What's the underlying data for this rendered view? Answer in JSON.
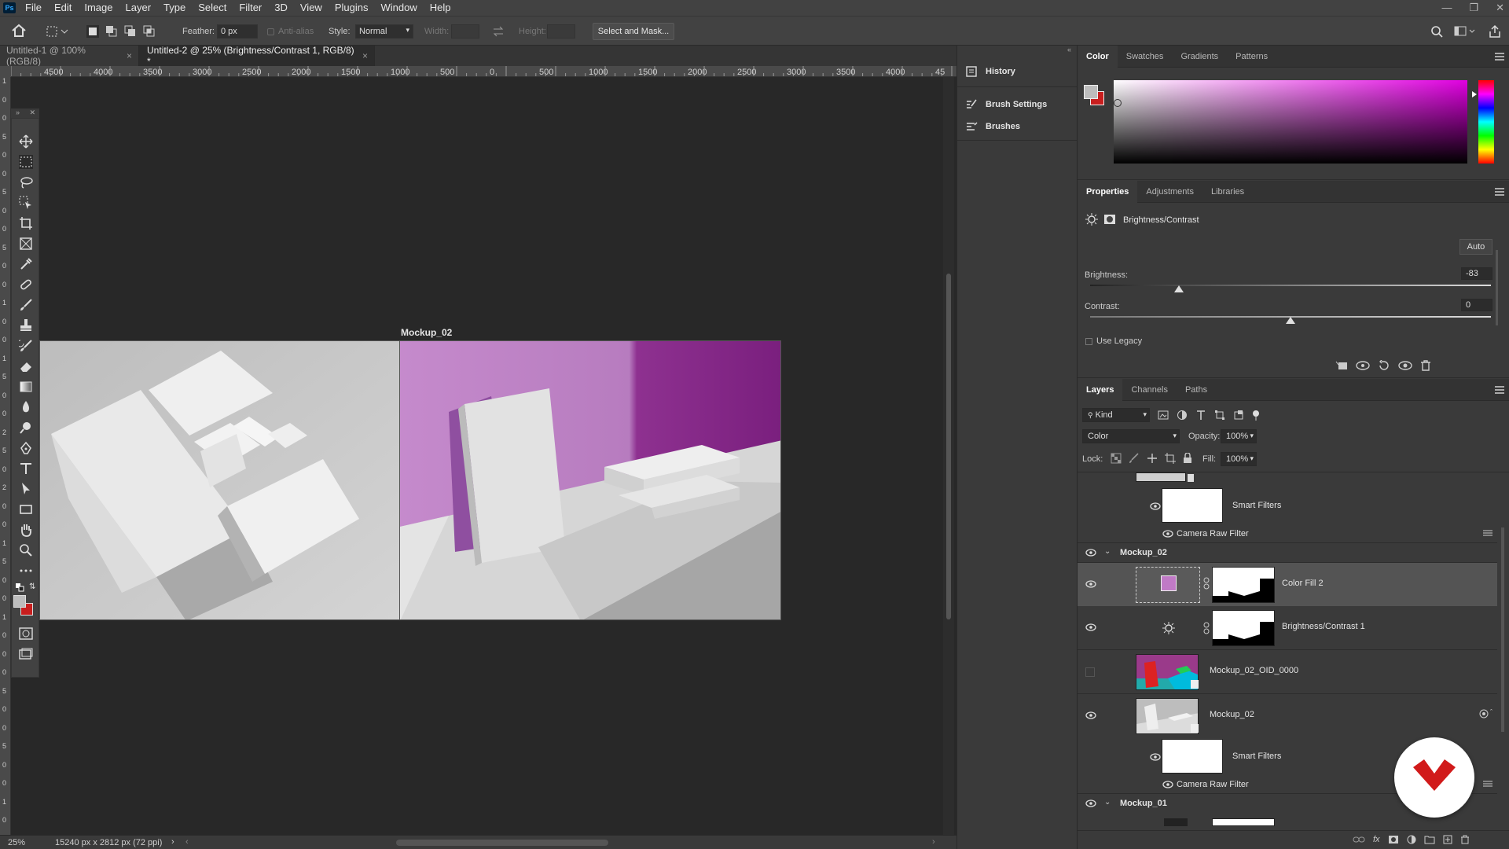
{
  "app": {
    "logo": "Ps"
  },
  "menubar": [
    "File",
    "Edit",
    "Image",
    "Layer",
    "Type",
    "Select",
    "Filter",
    "3D",
    "View",
    "Plugins",
    "Window",
    "Help"
  ],
  "options": {
    "feather_label": "Feather:",
    "feather_value": "0 px",
    "antialias_label": "Anti-alias",
    "style_label": "Style:",
    "style_value": "Normal",
    "width_label": "Width:",
    "height_label": "Height:",
    "select_mask": "Select and Mask..."
  },
  "tabs": [
    {
      "label": "Untitled-1 @ 100% (RGB/8)",
      "close": "×"
    },
    {
      "label": "Untitled-2 @ 25% (Brightness/Contrast 1, RGB/8) *",
      "close": "×"
    }
  ],
  "ruler": {
    "h_ticks": [
      "4500",
      "4000",
      "3500",
      "3000",
      "2500",
      "2000",
      "1500",
      "1000",
      "500",
      "0",
      "500",
      "1000",
      "1500",
      "2000",
      "2500",
      "3000",
      "3500",
      "4000",
      "45"
    ],
    "v_ticks": [
      "1",
      "0",
      "0",
      "5",
      "0",
      "0",
      "5",
      "0",
      "0",
      "5",
      "0",
      "0",
      "1",
      "0",
      "0",
      "1",
      "5",
      "0",
      "0",
      "2",
      "5",
      "0",
      "2",
      "0",
      "0",
      "1",
      "5",
      "0",
      "0",
      "1",
      "0",
      "0",
      "0",
      "5",
      "0",
      "0",
      "5",
      "0",
      "0",
      "1",
      "0"
    ]
  },
  "canvas": {
    "artboard_label": "Mockup_02"
  },
  "status": {
    "zoom": "25%",
    "doc_size": "15240 px x 2812 px (72 ppi)",
    "arrow": "›"
  },
  "midpanel": {
    "history": "History",
    "brush_settings": "Brush Settings",
    "brushes": "Brushes"
  },
  "color_panel": {
    "tabs": [
      "Color",
      "Swatches",
      "Gradients",
      "Patterns"
    ],
    "fg": "#bdbdbd",
    "bg": "#c81e1e"
  },
  "properties": {
    "tabs": [
      "Properties",
      "Adjustments",
      "Libraries"
    ],
    "title": "Brightness/Contrast",
    "auto": "Auto",
    "brightness_label": "Brightness:",
    "brightness_value": "-83",
    "contrast_label": "Contrast:",
    "contrast_value": "0",
    "use_legacy": "Use Legacy"
  },
  "layers_panel": {
    "tabs": [
      "Layers",
      "Channels",
      "Paths"
    ],
    "kind": "Kind",
    "blend_mode": "Color",
    "opacity_label": "Opacity:",
    "opacity_value": "100%",
    "lock_label": "Lock:",
    "fill_label": "Fill:",
    "fill_value": "100%",
    "layers": {
      "smart_filters_top": "Smart Filters",
      "camera_raw_top": "Camera Raw Filter",
      "group_mockup02": "Mockup_02",
      "color_fill": "Color Fill 2",
      "brightness_contrast": "Brightness/Contrast 1",
      "oid": "Mockup_02_OID_0000",
      "mockup02": "Mockup_02",
      "smart_filters": "Smart Filters",
      "camera_raw": "Camera Raw Filter",
      "group_mockup01": "Mockup_01"
    }
  },
  "colors": {
    "accent": "#31a8ff",
    "ps_bg": "#001e36",
    "selected_row": "#545454",
    "brand_red": "#d11a1a"
  }
}
